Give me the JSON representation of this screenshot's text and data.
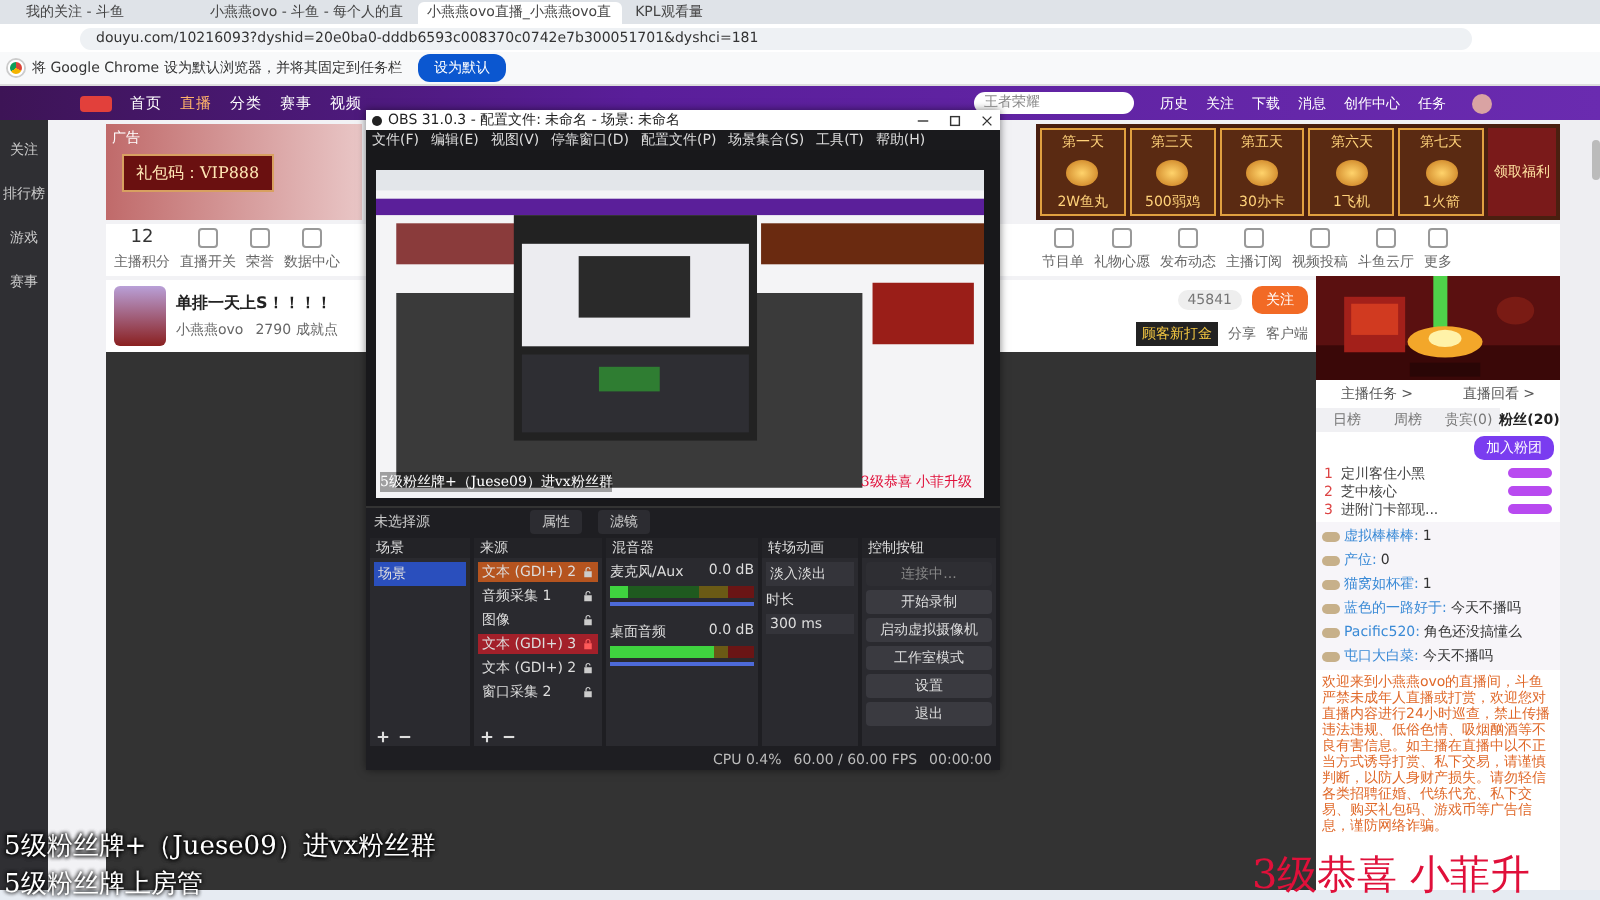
{
  "browser": {
    "tabs": [
      {
        "title": "我的关注 - 斗鱼",
        "selected": false
      },
      {
        "title": "小燕燕ovo - 斗鱼 - 每个人的直",
        "selected": false
      },
      {
        "title": "小燕燕ovo直播_小燕燕ovo直",
        "selected": true
      },
      {
        "title": "KPL观看量",
        "selected": false
      }
    ],
    "url": "douyu.com/10216093?dyshid=20e0ba0-dddb6593c008370c0742e7b300051701&dyshci=181",
    "infobar": {
      "message": "将 Google Chrome 设为默认浏览器，并将其固定到任务栏",
      "button": "设为默认"
    }
  },
  "site": {
    "nav": [
      {
        "label": "首页",
        "selected": false
      },
      {
        "label": "直播",
        "selected": true
      },
      {
        "label": "分类",
        "selected": false
      },
      {
        "label": "赛事",
        "selected": false
      },
      {
        "label": "视频",
        "selected": false
      }
    ],
    "search_placeholder": "王者荣耀",
    "header_icons": [
      "历史",
      "关注",
      "下载",
      "消息",
      "创作中心",
      "任务"
    ],
    "sidebar": [
      "关注",
      "排行榜",
      "游戏",
      "赛事"
    ],
    "ad": {
      "tag": "广告",
      "code": "礼包码：VIP888"
    },
    "rewards": [
      {
        "day": "第一天",
        "prize": "2W鱼丸"
      },
      {
        "day": "第三天",
        "prize": "500弱鸡"
      },
      {
        "day": "第五天",
        "prize": "30办卡"
      },
      {
        "day": "第六天",
        "prize": "1飞机"
      },
      {
        "day": "第七天",
        "prize": "1火箭"
      }
    ],
    "reward_claim": "领取福利",
    "score": {
      "value": "12",
      "label": "主播积分"
    },
    "tools_left": [
      "直播开关",
      "荣誉",
      "数据中心"
    ],
    "tools_right": [
      "节目单",
      "礼物心愿",
      "发布动态",
      "主播订阅",
      "视频投稿",
      "斗鱼云厅",
      "更多"
    ],
    "room": {
      "title": "单排一天上S！！！！",
      "streamer": "小燕燕ovo",
      "points": "2790 成就点",
      "followers": "45841",
      "follow": "关注",
      "badge": "顾客新打金",
      "share": "分享",
      "client": "客户端"
    }
  },
  "chat": {
    "links": [
      "主播任务 >",
      "直播回看 >"
    ],
    "tabs": [
      {
        "label": "日榜",
        "selected": false
      },
      {
        "label": "周榜",
        "selected": false
      },
      {
        "label": "贵宾(0)",
        "selected": false
      },
      {
        "label": "粉丝(20)",
        "selected": true
      }
    ],
    "join": "加入粉团",
    "ranks": [
      {
        "rank": "1",
        "name": "定川客住小黑"
      },
      {
        "rank": "2",
        "name": "芝中核心"
      },
      {
        "rank": "3",
        "name": "进附门卡部现..."
      }
    ],
    "messages": [
      {
        "user": "虚拟棒棒棒:",
        "text": "1"
      },
      {
        "user": "产位:",
        "text": "0"
      },
      {
        "user": "猫窝如杯霍:",
        "text": "1"
      },
      {
        "user": "蓝色的一路好于:",
        "text": "今天不播吗"
      },
      {
        "user": "Pacific520:",
        "text": "角色还没搞懂么"
      },
      {
        "user": "屯口大白菜:",
        "text": "今天不播吗"
      }
    ],
    "notice": "欢迎来到小燕燕ovo的直播间，斗鱼严禁未成年人直播或打赏，欢迎您对直播内容进行24小时巡查，禁止传播违法违规、低俗色情、吸烟酗酒等不良有害信息。如主播在直播中以不正当方式诱导打赏、私下交易，请谨慎判断，以防人身财产损失。请勿轻信各类招聘征婚、代练代充、私下交易、购买礼包码、游戏币等广告信息，谨防网络诈骗。"
  },
  "obs": {
    "title": "OBS 31.0.3 - 配置文件: 未命名 - 场景: 未命名",
    "menu": [
      "文件(F)",
      "编辑(E)",
      "视图(V)",
      "停靠窗口(D)",
      "配置文件(P)",
      "场景集合(S)",
      "工具(T)",
      "帮助(H)"
    ],
    "preview_captions": {
      "left": "5级粉丝牌+（Juese09）进vx粉丝群",
      "right": "3级恭喜 小菲升级"
    },
    "source_bar": {
      "label": "未选择源",
      "buttons": [
        "属性",
        "滤镜"
      ]
    },
    "docks": {
      "scenes": "场景",
      "sources": "来源",
      "mixer": "混音器",
      "transitions": "转场动画",
      "controls": "控制按钮"
    },
    "scenes": [
      {
        "name": "场景",
        "selected": true
      }
    ],
    "sources": [
      {
        "name": "文本 (GDI+) 2",
        "color": "#b5541f",
        "locked": false
      },
      {
        "name": "音频采集 1",
        "locked": false
      },
      {
        "name": "图像",
        "locked": false
      },
      {
        "name": "文本 (GDI+) 3",
        "color": "#a3202a",
        "locked": true
      },
      {
        "name": "文本 (GDI+) 2",
        "locked": false
      },
      {
        "name": "窗口采集 2",
        "locked": false
      }
    ],
    "channels": [
      {
        "name": "麦克风/Aux",
        "reading": "0.0 dB",
        "meter": {
          "level": 0.12
        },
        "fader": {
          "level": 1
        }
      },
      {
        "name": "桌面音频",
        "reading": "0.0 dB",
        "meter": {
          "level": 0.72
        },
        "fader": {
          "level": 1
        }
      }
    ],
    "transition": {
      "type": "淡入淡出",
      "duration_label": "时长",
      "duration": "300 ms"
    },
    "controls": [
      {
        "label": "连接中...",
        "disabled": true
      },
      {
        "label": "开始录制",
        "disabled": false
      },
      {
        "label": "启动虚拟摄像机",
        "disabled": false
      },
      {
        "label": "工作室模式",
        "disabled": false
      },
      {
        "label": "设置",
        "disabled": false
      },
      {
        "label": "退出",
        "disabled": false
      }
    ],
    "status": {
      "cpu": "CPU 0.4%",
      "fps": "60.00 / 60.00 FPS",
      "time": "00:00:00"
    }
  },
  "captions": {
    "line1": "5级粉丝牌+（Juese09）进vx粉丝群",
    "line2": "5级粉丝牌上房管",
    "red": "3级恭喜  小菲升"
  }
}
